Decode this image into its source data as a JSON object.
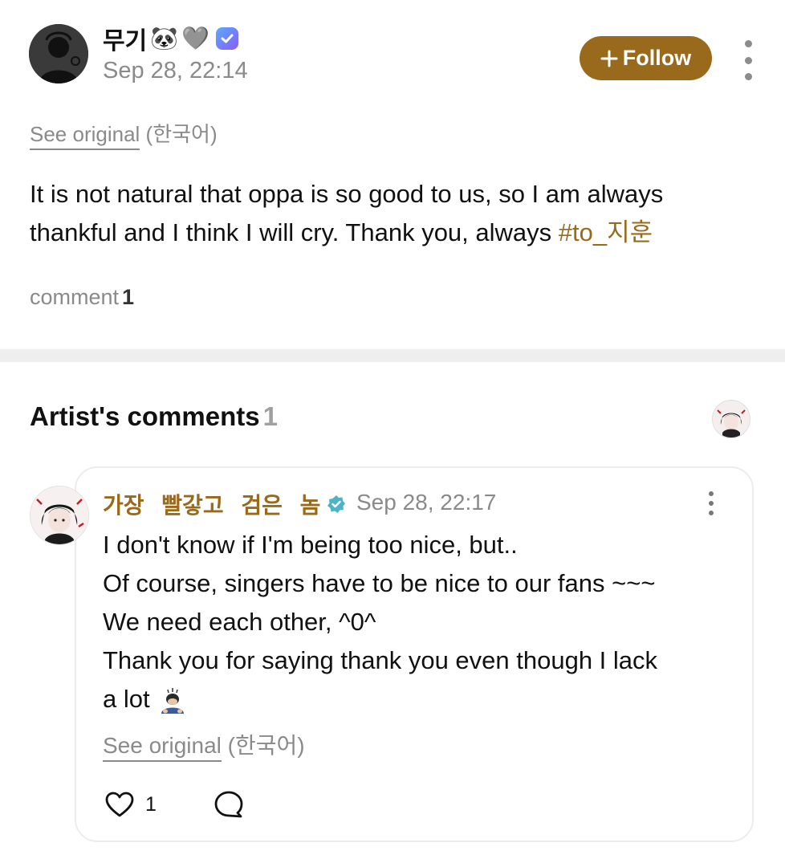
{
  "post": {
    "username": "무기",
    "username_emojis": [
      "🐼",
      "🩶"
    ],
    "timestamp": "Sep 28, 22:14",
    "follow_label": "Follow",
    "follow_icon": "plus-icon",
    "see_original": "See original",
    "original_language": "(한국어)",
    "body_text": "It is not natural that oppa is so good to us, so I am always thankful and I think I will cry. Thank you, always ",
    "hashtag": "#to_지훈",
    "comment_label": "comment",
    "comment_count": "1"
  },
  "artist_comments": {
    "title": "Artist's comments",
    "count": "1",
    "reply": {
      "author": "가장 빨갛고 검은 놈",
      "timestamp": "Sep 28, 22:17",
      "lines": [
        "I don't know if I'm being too nice, but..",
        "Of course, singers have to be nice to our fans ~~~",
        "We need each other, ^0^",
        "Thank you for saying thank you even though I lack",
        "a lot"
      ],
      "see_original": "See original",
      "original_language": "(한국어)",
      "like_count": "1"
    }
  },
  "colors": {
    "accent": "#9a6a1c",
    "muted_text": "#8a8a8a",
    "divider": "#eeeeee",
    "verified_badge": "#4fb3c8"
  }
}
